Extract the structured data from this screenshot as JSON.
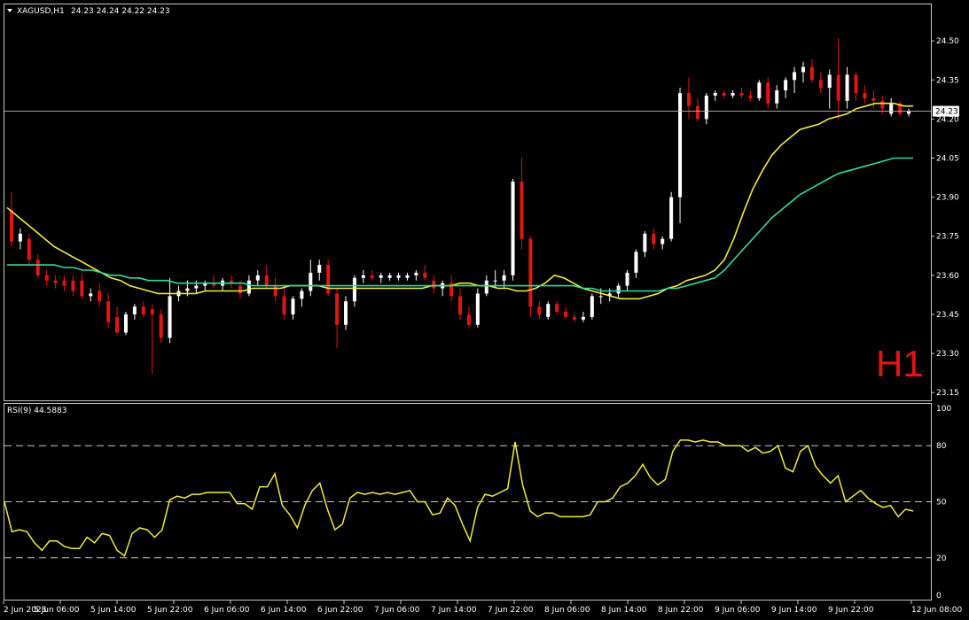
{
  "header": {
    "symbol": "XAGUSD,H1",
    "ohlc": "24.23 24.24 24.22 24.23"
  },
  "timeframe_label": "H1",
  "price_tag": "24.23",
  "colors": {
    "background": "#000000",
    "bull": "#ffffff",
    "bear": "#e31414",
    "ma_fast": "#f2ec3a",
    "ma_slow": "#2fdc9a",
    "rsi": "#f2ec3a",
    "grid": "#c8c8c8"
  },
  "chart_data": [
    {
      "type": "candlestick",
      "title": "XAGUSD,H1",
      "ylim": [
        23.12,
        24.64
      ],
      "y_ticks": [
        "24.50",
        "24.35",
        "24.20",
        "24.05",
        "23.90",
        "23.75",
        "23.60",
        "23.45",
        "23.30",
        "23.15"
      ],
      "last_price": 24.23,
      "series": [
        {
          "name": "",
          "role": "ma_fast",
          "values": [
            23.86,
            23.83,
            23.8,
            23.77,
            23.74,
            23.71,
            23.69,
            23.67,
            23.65,
            23.63,
            23.61,
            23.59,
            23.58,
            23.56,
            23.55,
            23.54,
            23.53,
            23.53,
            23.53,
            23.53,
            23.53,
            23.54,
            23.54,
            23.54,
            23.54,
            23.54,
            23.55,
            23.55,
            23.55,
            23.55,
            23.56,
            23.56,
            23.56,
            23.56,
            23.55,
            23.55,
            23.55,
            23.55,
            23.55,
            23.55,
            23.55,
            23.55,
            23.55,
            23.55,
            23.55,
            23.56,
            23.56,
            23.56,
            23.57,
            23.57,
            23.56,
            23.56,
            23.55,
            23.55,
            23.54,
            23.54,
            23.55,
            23.57,
            23.6,
            23.59,
            23.57,
            23.55,
            23.54,
            23.53,
            23.52,
            23.51,
            23.51,
            23.51,
            23.52,
            23.53,
            23.55,
            23.56,
            23.58,
            23.59,
            23.6,
            23.62,
            23.66,
            23.74,
            23.84,
            23.93,
            24.0,
            24.06,
            24.1,
            24.13,
            24.16,
            24.17,
            24.18,
            24.2,
            24.21,
            24.22,
            24.24,
            24.25,
            24.26,
            24.26,
            24.26,
            24.25,
            24.25
          ]
        },
        {
          "name": "",
          "role": "ma_slow",
          "values": [
            23.64,
            23.64,
            23.64,
            23.64,
            23.64,
            23.64,
            23.63,
            23.63,
            23.62,
            23.62,
            23.61,
            23.6,
            23.6,
            23.59,
            23.59,
            23.58,
            23.58,
            23.58,
            23.57,
            23.57,
            23.57,
            23.57,
            23.57,
            23.57,
            23.57,
            23.57,
            23.56,
            23.56,
            23.56,
            23.56,
            23.56,
            23.56,
            23.56,
            23.56,
            23.56,
            23.56,
            23.56,
            23.56,
            23.56,
            23.56,
            23.56,
            23.56,
            23.56,
            23.56,
            23.56,
            23.56,
            23.56,
            23.56,
            23.56,
            23.56,
            23.56,
            23.56,
            23.56,
            23.56,
            23.56,
            23.56,
            23.56,
            23.56,
            23.56,
            23.56,
            23.56,
            23.55,
            23.55,
            23.54,
            23.54,
            23.54,
            23.54,
            23.54,
            23.54,
            23.54,
            23.55,
            23.55,
            23.56,
            23.57,
            23.58,
            23.59,
            23.62,
            23.66,
            23.7,
            23.74,
            23.78,
            23.82,
            23.85,
            23.88,
            23.91,
            23.93,
            23.95,
            23.97,
            23.99,
            24.0,
            24.01,
            24.02,
            24.03,
            24.04,
            24.05,
            24.05,
            24.05
          ]
        }
      ],
      "candles": [
        [
          23.85,
          23.92,
          23.71,
          23.73
        ],
        [
          23.73,
          23.78,
          23.7,
          23.76
        ],
        [
          23.74,
          23.76,
          23.64,
          23.66
        ],
        [
          23.66,
          23.68,
          23.59,
          23.6
        ],
        [
          23.6,
          23.62,
          23.56,
          23.58
        ],
        [
          23.58,
          23.6,
          23.55,
          23.57
        ],
        [
          23.58,
          23.6,
          23.54,
          23.56
        ],
        [
          23.58,
          23.6,
          23.52,
          23.54
        ],
        [
          23.58,
          23.61,
          23.51,
          23.52
        ],
        [
          23.52,
          23.55,
          23.5,
          23.53
        ],
        [
          23.54,
          23.57,
          23.48,
          23.5
        ],
        [
          23.5,
          23.53,
          23.4,
          23.42
        ],
        [
          23.44,
          23.48,
          23.37,
          23.38
        ],
        [
          23.38,
          23.46,
          23.37,
          23.45
        ],
        [
          23.45,
          23.49,
          23.43,
          23.48
        ],
        [
          23.48,
          23.5,
          23.44,
          23.45
        ],
        [
          23.47,
          23.49,
          23.22,
          23.45
        ],
        [
          23.45,
          23.47,
          23.34,
          23.36
        ],
        [
          23.36,
          23.59,
          23.34,
          23.52
        ],
        [
          23.52,
          23.56,
          23.5,
          23.54
        ],
        [
          23.54,
          23.58,
          23.52,
          23.55
        ],
        [
          23.55,
          23.58,
          23.53,
          23.56
        ],
        [
          23.56,
          23.58,
          23.54,
          23.57
        ],
        [
          23.57,
          23.6,
          23.55,
          23.56
        ],
        [
          23.56,
          23.59,
          23.54,
          23.58
        ],
        [
          23.58,
          23.6,
          23.55,
          23.57
        ],
        [
          23.56,
          23.58,
          23.51,
          23.53
        ],
        [
          23.53,
          23.6,
          23.52,
          23.58
        ],
        [
          23.58,
          23.62,
          23.56,
          23.6
        ],
        [
          23.6,
          23.64,
          23.55,
          23.56
        ],
        [
          23.56,
          23.59,
          23.5,
          23.52
        ],
        [
          23.52,
          23.56,
          23.43,
          23.45
        ],
        [
          23.45,
          23.52,
          23.43,
          23.51
        ],
        [
          23.51,
          23.55,
          23.48,
          23.54
        ],
        [
          23.54,
          23.66,
          23.52,
          23.61
        ],
        [
          23.61,
          23.66,
          23.58,
          23.64
        ],
        [
          23.64,
          23.66,
          23.52,
          23.53
        ],
        [
          23.53,
          23.55,
          23.32,
          23.41
        ],
        [
          23.41,
          23.52,
          23.39,
          23.5
        ],
        [
          23.5,
          23.6,
          23.48,
          23.59
        ],
        [
          23.59,
          23.62,
          23.57,
          23.6
        ],
        [
          23.6,
          23.62,
          23.58,
          23.59
        ],
        [
          23.59,
          23.61,
          23.57,
          23.6
        ],
        [
          23.59,
          23.61,
          23.58,
          23.6
        ],
        [
          23.59,
          23.61,
          23.58,
          23.6
        ],
        [
          23.59,
          23.61,
          23.58,
          23.6
        ],
        [
          23.6,
          23.62,
          23.58,
          23.61
        ],
        [
          23.61,
          23.64,
          23.58,
          23.59
        ],
        [
          23.58,
          23.6,
          23.53,
          23.55
        ],
        [
          23.55,
          23.58,
          23.52,
          23.57
        ],
        [
          23.57,
          23.6,
          23.5,
          23.52
        ],
        [
          23.52,
          23.55,
          23.43,
          23.45
        ],
        [
          23.45,
          23.48,
          23.4,
          23.41
        ],
        [
          23.41,
          23.55,
          23.4,
          23.53
        ],
        [
          23.53,
          23.6,
          23.52,
          23.58
        ],
        [
          23.58,
          23.62,
          23.55,
          23.58
        ],
        [
          23.58,
          23.62,
          23.55,
          23.6
        ],
        [
          23.6,
          23.97,
          23.58,
          23.96
        ],
        [
          23.96,
          24.05,
          23.7,
          23.74
        ],
        [
          23.74,
          23.75,
          23.44,
          23.48
        ],
        [
          23.48,
          23.5,
          23.43,
          23.45
        ],
        [
          23.44,
          23.5,
          23.43,
          23.49
        ],
        [
          23.49,
          23.5,
          23.45,
          23.46
        ],
        [
          23.46,
          23.48,
          23.43,
          23.44
        ],
        [
          23.44,
          23.45,
          23.42,
          23.43
        ],
        [
          23.43,
          23.46,
          23.42,
          23.44
        ],
        [
          23.44,
          23.53,
          23.43,
          23.52
        ],
        [
          23.52,
          23.55,
          23.49,
          23.52
        ],
        [
          23.52,
          23.55,
          23.5,
          23.53
        ],
        [
          23.53,
          23.57,
          23.51,
          23.56
        ],
        [
          23.56,
          23.62,
          23.54,
          23.61
        ],
        [
          23.61,
          23.7,
          23.59,
          23.69
        ],
        [
          23.69,
          23.77,
          23.67,
          23.76
        ],
        [
          23.76,
          23.78,
          23.7,
          23.72
        ],
        [
          23.72,
          23.75,
          23.7,
          23.74
        ],
        [
          23.74,
          23.92,
          23.73,
          23.9
        ],
        [
          23.9,
          24.32,
          23.8,
          24.3
        ],
        [
          24.3,
          24.36,
          24.2,
          24.25
        ],
        [
          24.25,
          24.28,
          24.19,
          24.2
        ],
        [
          24.2,
          24.3,
          24.18,
          24.29
        ],
        [
          24.29,
          24.31,
          24.27,
          24.3
        ],
        [
          24.3,
          24.31,
          24.28,
          24.29
        ],
        [
          24.29,
          24.31,
          24.28,
          24.3
        ],
        [
          24.3,
          24.32,
          24.28,
          24.29
        ],
        [
          24.29,
          24.31,
          24.27,
          24.28
        ],
        [
          24.28,
          24.35,
          24.27,
          24.34
        ],
        [
          24.34,
          24.36,
          24.24,
          24.26
        ],
        [
          24.26,
          24.33,
          24.24,
          24.31
        ],
        [
          24.31,
          24.36,
          24.28,
          24.35
        ],
        [
          24.35,
          24.4,
          24.3,
          24.38
        ],
        [
          24.38,
          24.42,
          24.34,
          24.4
        ],
        [
          24.4,
          24.43,
          24.34,
          24.35
        ],
        [
          24.35,
          24.38,
          24.3,
          24.32
        ],
        [
          24.32,
          24.39,
          24.24,
          24.37
        ],
        [
          24.37,
          24.51,
          24.2,
          24.27
        ],
        [
          24.27,
          24.4,
          24.24,
          24.37
        ],
        [
          24.37,
          24.38,
          24.27,
          24.3
        ],
        [
          24.3,
          24.33,
          24.26,
          24.28
        ],
        [
          24.28,
          24.31,
          24.24,
          24.27
        ],
        [
          24.27,
          24.29,
          24.22,
          24.24
        ],
        [
          24.22,
          24.28,
          24.21,
          24.26
        ],
        [
          24.26,
          24.27,
          24.21,
          24.22
        ],
        [
          24.22,
          24.24,
          24.21,
          24.23
        ]
      ]
    },
    {
      "type": "line",
      "title": "RSI(9) 44.5883",
      "ylim": [
        0,
        100
      ],
      "y_ticks": [
        "100",
        "80",
        "50",
        "20",
        "0"
      ],
      "levels": [
        80,
        50,
        20
      ],
      "series": [
        {
          "name": "RSI(9)",
          "values": [
            50,
            34,
            35,
            34,
            28,
            24,
            29,
            29,
            26,
            25,
            25,
            31,
            28,
            33,
            32,
            24,
            21,
            33,
            36,
            35,
            31,
            35,
            51,
            53,
            52,
            54,
            54,
            55,
            55,
            55,
            55,
            49,
            49,
            46,
            58,
            58,
            65,
            48,
            43,
            36,
            48,
            56,
            60,
            46,
            35,
            38,
            52,
            55,
            54,
            55,
            54,
            55,
            54,
            55,
            56,
            50,
            50,
            43,
            44,
            52,
            48,
            38,
            29,
            47,
            54,
            53,
            55,
            57,
            82,
            59,
            45,
            42,
            44,
            44,
            42,
            42,
            42,
            42,
            43,
            50,
            50,
            52,
            58,
            60,
            64,
            70,
            63,
            59,
            62,
            77,
            83,
            83,
            82,
            83,
            82,
            82,
            80,
            80,
            80,
            77,
            79,
            76,
            77,
            80,
            68,
            66,
            77,
            80,
            69,
            64,
            60,
            64,
            50,
            53,
            56,
            52,
            49,
            47,
            48,
            42,
            46,
            45
          ]
        }
      ]
    }
  ],
  "x_axis": {
    "labels": [
      "2 Jun 2023",
      "5 Jun 06:00",
      "5 Jun 14:00",
      "5 Jun 22:00",
      "6 Jun 06:00",
      "6 Jun 14:00",
      "6 Jun 22:00",
      "7 Jun 06:00",
      "7 Jun 14:00",
      "7 Jun 22:00",
      "8 Jun 06:00",
      "8 Jun 14:00",
      "8 Jun 22:00",
      "9 Jun 06:00",
      "9 Jun 14:00",
      "9 Jun 22:00",
      "12 Jun 08:00"
    ]
  }
}
